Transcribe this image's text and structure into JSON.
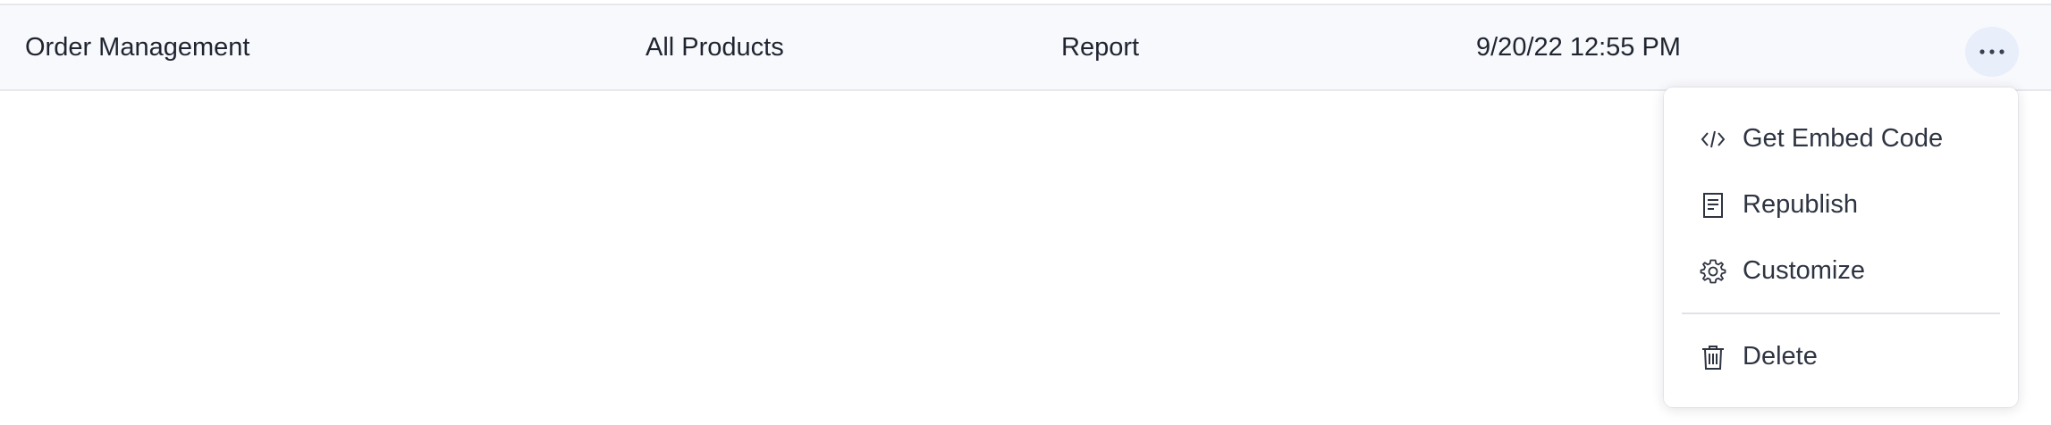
{
  "row": {
    "name": "Order Management",
    "product": "All Products",
    "type": "Report",
    "date": "9/20/22 12:55 PM"
  },
  "menu": {
    "items": [
      {
        "label": "Get Embed Code",
        "icon": "code-icon"
      },
      {
        "label": "Republish",
        "icon": "document-icon"
      },
      {
        "label": "Customize",
        "icon": "gear-icon"
      },
      {
        "label": "Delete",
        "icon": "trash-icon"
      }
    ]
  },
  "colors": {
    "row_background": "#f8f9fc",
    "more_button_background": "#e8eefa",
    "text": "#1f2430",
    "menu_text": "#2e3442"
  }
}
